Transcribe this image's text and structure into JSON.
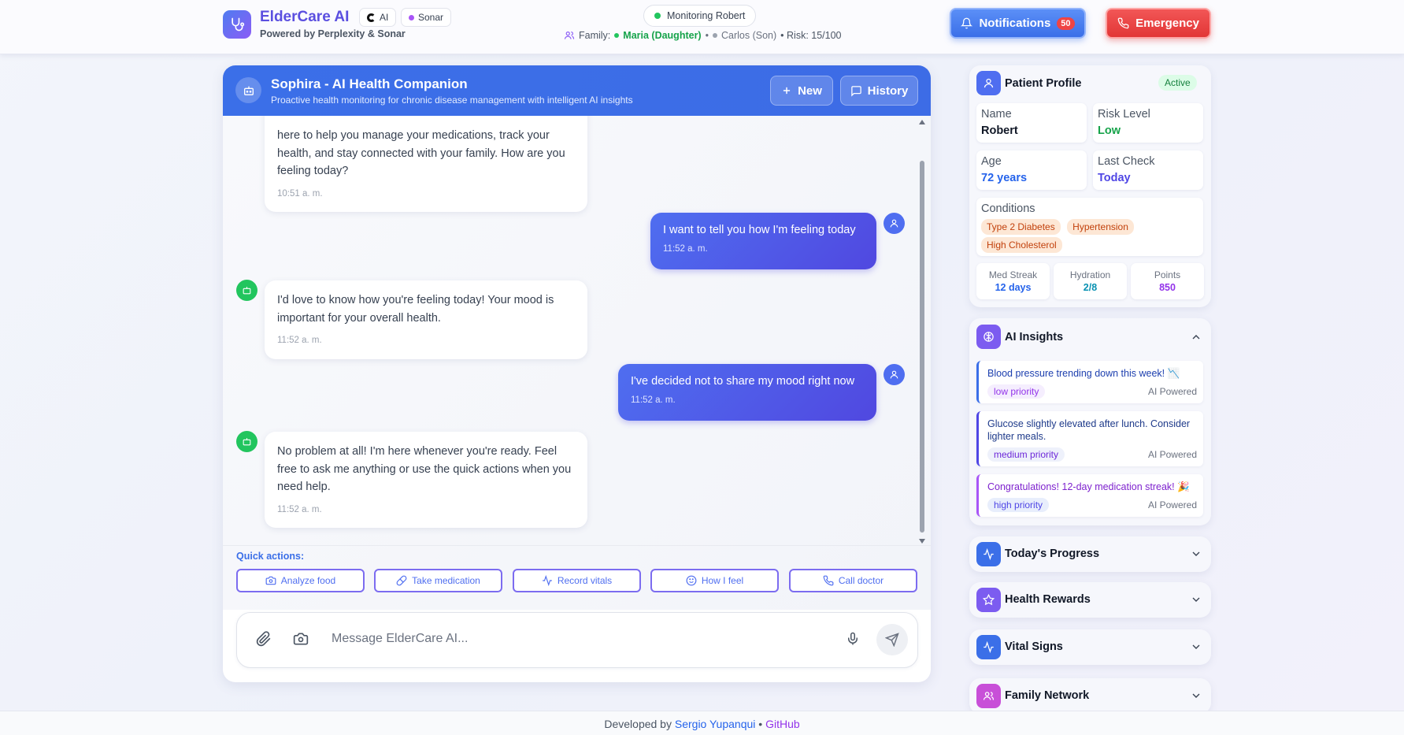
{
  "header": {
    "brand_title": "ElderCare AI",
    "brand_sub": "Powered by Perplexity & Sonar",
    "pill_ai": "AI",
    "pill_sonar": "Sonar",
    "monitoring": "Monitoring Robert",
    "family_label": "Family:",
    "family_member_1": "Maria (Daughter)",
    "family_sep": "•",
    "family_member_2": "Carlos (Son)",
    "risk": "• Risk: 15/100",
    "notifications_label": "Notifications",
    "notifications_count": "50",
    "emergency_label": "Emergency"
  },
  "chat": {
    "title": "Sophira - AI Health Companion",
    "subtitle": "Proactive health monitoring for chronic disease management with intelligent AI insights",
    "new_label": "New",
    "history_label": "History",
    "messages": [
      {
        "role": "ai",
        "text": "here to help you manage your medications, track your health, and stay connected with your family. How are you feeling today?",
        "time": "10:51 a. m."
      },
      {
        "role": "user",
        "text": "I want to tell you how I'm feeling today",
        "time": "11:52 a. m."
      },
      {
        "role": "ai",
        "text": "I'd love to know how you're feeling today! Your mood is important for your overall health.",
        "time": "11:52 a. m."
      },
      {
        "role": "user",
        "text": "I've decided not to share my mood right now",
        "time": "11:52 a. m."
      },
      {
        "role": "ai",
        "text": "No problem at all! I'm here whenever you're ready. Feel free to ask me anything or use the quick actions when you need help.",
        "time": "11:52 a. m."
      }
    ],
    "quick_label": "Quick actions:",
    "quick_actions": [
      "Analyze food",
      "Take medication",
      "Record vitals",
      "How I feel",
      "Call doctor"
    ],
    "composer_placeholder": "Message ElderCare AI..."
  },
  "profile": {
    "title": "Patient Profile",
    "status": "Active",
    "name_label": "Name",
    "name_value": "Robert",
    "risk_label": "Risk Level",
    "risk_value": "Low",
    "age_label": "Age",
    "age_value": "72 years",
    "last_check_label": "Last Check",
    "last_check_value": "Today",
    "conditions_label": "Conditions",
    "conditions": [
      "Type 2 Diabetes",
      "Hypertension",
      "High Cholesterol"
    ],
    "stats": [
      {
        "label": "Med Streak",
        "value": "12 days",
        "color": "#2563eb"
      },
      {
        "label": "Hydration",
        "value": "2/8",
        "color": "#0891b2"
      },
      {
        "label": "Points",
        "value": "850",
        "color": "#9333ea"
      }
    ]
  },
  "insights": {
    "title": "AI Insights",
    "items": [
      {
        "text": "Blood pressure trending down this week! 📉",
        "priority": "low priority",
        "source": "AI Powered",
        "color": "#1e40af",
        "prio_color": "#9333ea"
      },
      {
        "text": "Glucose slightly elevated after lunch. Consider lighter meals.",
        "priority": "medium priority",
        "source": "AI Powered",
        "color": "#1e40af",
        "prio_color": "#6d28d9"
      },
      {
        "text": "Congratulations! 12-day medication streak! 🎉",
        "priority": "high priority",
        "source": "AI Powered",
        "color": "#7e22ce",
        "prio_color": "#4f46e5"
      }
    ]
  },
  "sections": {
    "progress": "Today's Progress",
    "rewards": "Health Rewards",
    "vitals": "Vital Signs",
    "family": "Family Network"
  },
  "footer": {
    "prefix": "Developed by",
    "author": "Sergio Yupanqui",
    "sep": "•",
    "github": "GitHub"
  },
  "colors": {
    "primary": "#3b6fe8",
    "emergency": "#e23636",
    "success": "#22c55e"
  }
}
